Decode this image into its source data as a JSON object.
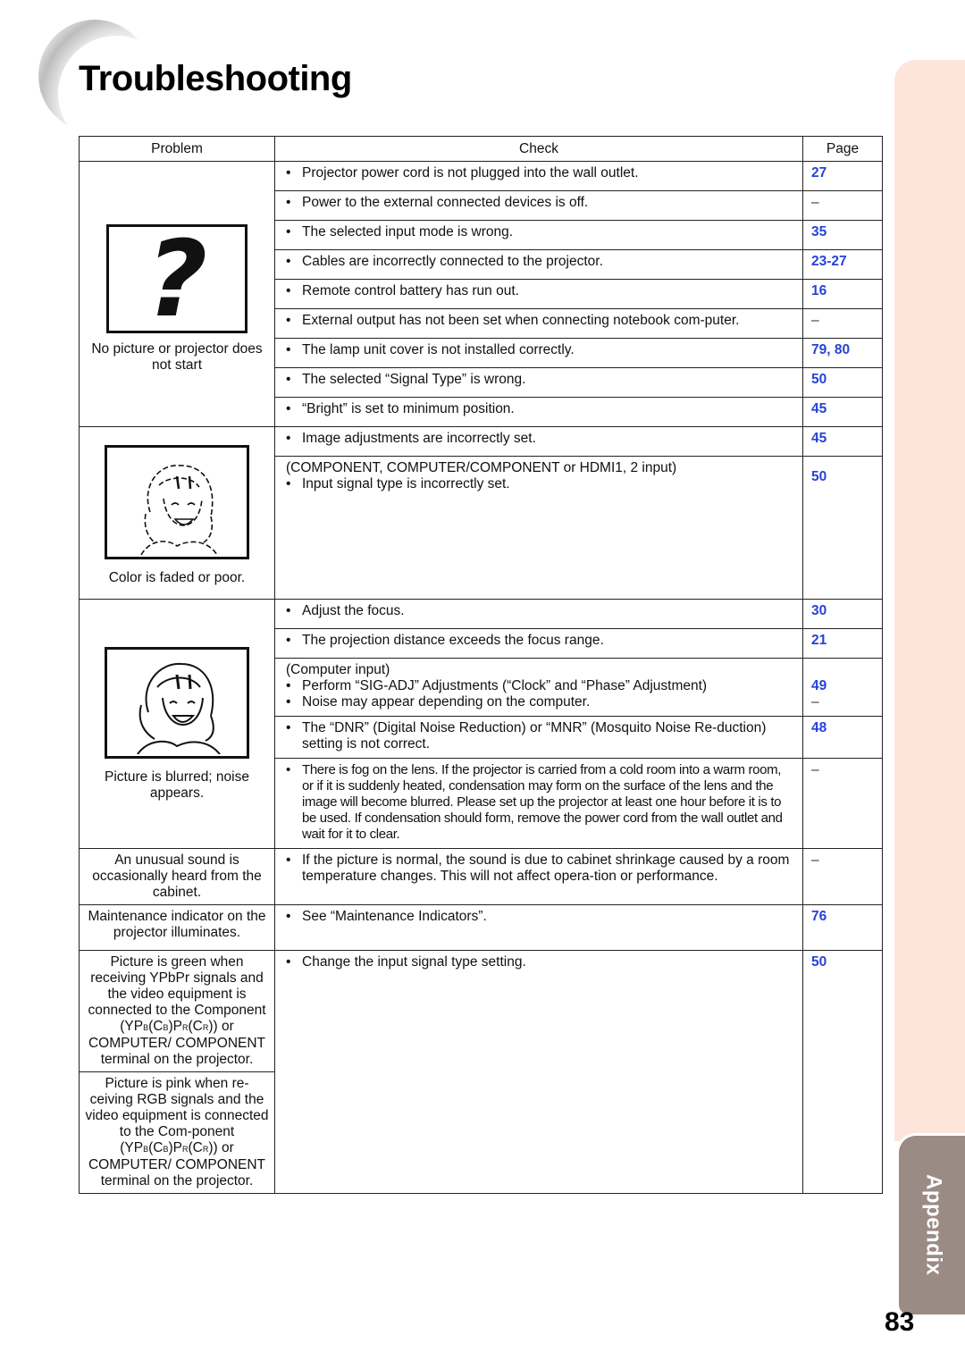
{
  "header": {
    "title": "Troubleshooting"
  },
  "side_tab": {
    "label": "Appendix"
  },
  "footer": {
    "page_number": "83"
  },
  "colors": {
    "page_link": "#2742d8",
    "side_band": "#fde5dc",
    "side_tab": "#9b8b85"
  },
  "table": {
    "headers": {
      "problem": "Problem",
      "check": "Check",
      "page": "Page"
    },
    "groups": [
      {
        "problem": "No picture or projector does not start",
        "illustration": "question-mark",
        "qmark": "?",
        "rows": [
          {
            "check": "Projector power cord is not plugged into the wall outlet.",
            "page": "27"
          },
          {
            "check": "Power to the external connected devices is off.",
            "page": "–"
          },
          {
            "check": "The selected input mode is wrong.",
            "page": "35"
          },
          {
            "check": "Cables are incorrectly connected to the projector.",
            "page": "23-27"
          },
          {
            "check": "Remote control battery has run out.",
            "page": "16"
          },
          {
            "check": "External output has not been set when connecting notebook com-puter.",
            "page": "–"
          },
          {
            "check": "The lamp unit cover is not installed correctly.",
            "page": "79, 80"
          },
          {
            "check": "The selected “Signal Type” is wrong.",
            "page": "50"
          },
          {
            "check": "“Bright” is set to minimum position.",
            "page": "45"
          }
        ]
      },
      {
        "problem": "Color is faded or poor.",
        "illustration": "girl-faded",
        "rows": [
          {
            "check": "Image adjustments are incorrectly set.",
            "page": "45"
          },
          {
            "note": "(COMPONENT, COMPUTER/COMPONENT or HDMI1, 2 input)",
            "check": "Input signal type is incorrectly set.",
            "page": "50"
          }
        ]
      },
      {
        "problem": "Picture is blurred; noise appears.",
        "illustration": "girl-blurred",
        "rows": [
          {
            "check": "Adjust the focus.",
            "page": "30"
          },
          {
            "check": "The projection distance exceeds the focus range.",
            "page": "21"
          },
          {
            "note": "(Computer input)",
            "check": "Perform “SIG-ADJ” Adjustments (“Clock” and “Phase” Adjustment)",
            "page": "49",
            "check2": "Noise may appear depending on the computer.",
            "page2": "–"
          },
          {
            "check": "The “DNR” (Digital Noise Reduction) or “MNR” (Mosquito Noise Re-duction) setting is not correct.",
            "page": "48"
          },
          {
            "check": "There is fog on the lens. If the projector is carried from a cold room into a warm room, or if it is suddenly heated, condensation may form on the surface of the lens and the image will become blurred. Please set up the projector at least one hour before it is to be used. If condensation should form, remove the power cord from the wall outlet and wait for it to clear.",
            "page": "–"
          }
        ]
      },
      {
        "problem": "An unusual sound is occasionally heard from the cabinet.",
        "rows": [
          {
            "check": "If the picture is normal, the sound is due to cabinet shrinkage caused by a room temperature changes. This will not affect opera-tion or performance.",
            "page": "–"
          }
        ]
      },
      {
        "problem": "Maintenance indicator on the projector illuminates.",
        "rows": [
          {
            "check": "See “Maintenance Indicators”.",
            "page": "76"
          }
        ]
      },
      {
        "problems": [
          {
            "a": "Picture is green when receiving YPbPr signals and the video equipment is connected to the Component (YP",
            "sub1": "B",
            "b": "(C",
            "sub2": "B",
            "c": ")P",
            "sub3": "R",
            "d": "(C",
            "sub4": "R",
            "e": ")) or COMPUTER/ COMPONENT terminal on the projector."
          },
          {
            "a": "Picture is pink when re-ceiving RGB signals and the video equipment is connected to the Com-ponent (YP",
            "sub1": "B",
            "b": "(C",
            "sub2": "B",
            "c": ")P",
            "sub3": "R",
            "d": "(C",
            "sub4": "R",
            "e": ")) or COMPUTER/ COMPONENT terminal on the projector."
          }
        ],
        "rows": [
          {
            "check": "Change the input signal type setting.",
            "page": "50"
          }
        ]
      }
    ],
    "bullet": "•"
  }
}
